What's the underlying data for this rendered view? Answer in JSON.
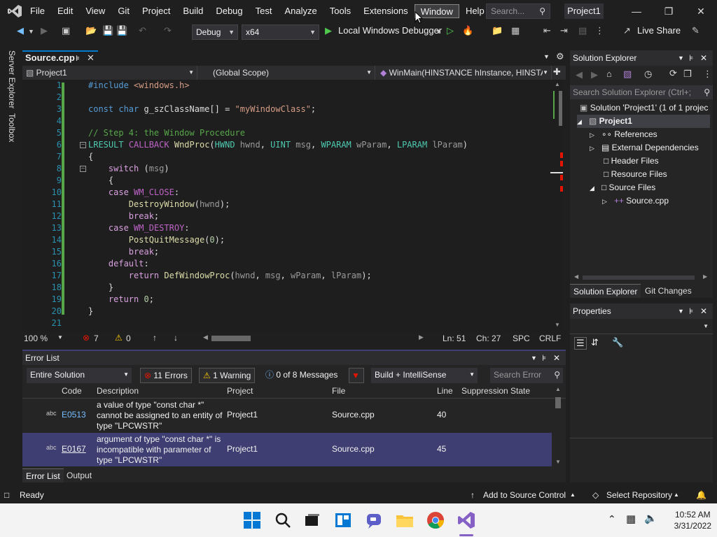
{
  "menubar": {
    "items": [
      "File",
      "Edit",
      "View",
      "Git",
      "Project",
      "Build",
      "Debug",
      "Test",
      "Analyze",
      "Tools",
      "Extensions",
      "Window",
      "Help"
    ],
    "search_placeholder": "Search...",
    "project_badge": "Project1"
  },
  "toolbar": {
    "config": "Debug",
    "platform": "x64",
    "debugger": "Local Windows Debugger",
    "live_share": "Live Share"
  },
  "left_sidebar": {
    "server_explorer": "Server Explorer",
    "toolbox": "Toolbox"
  },
  "editor": {
    "tab": "Source.cpp",
    "nav_project": "Project1",
    "nav_scope": "(Global Scope)",
    "nav_member": "WinMain(HINSTANCE hInstance, HINSTA",
    "lines": [
      {
        "n": "1",
        "t": "#include <windows.h>"
      },
      {
        "n": "2",
        "t": ""
      },
      {
        "n": "3",
        "t": "const char g_szClassName[] = \"myWindowClass\";"
      },
      {
        "n": "4",
        "t": ""
      },
      {
        "n": "5",
        "t": "// Step 4: the Window Procedure"
      },
      {
        "n": "6",
        "t": "LRESULT CALLBACK WndProc(HWND hwnd, UINT msg, WPARAM wParam, LPARAM lParam)"
      },
      {
        "n": "7",
        "t": "{"
      },
      {
        "n": "8",
        "t": "    switch (msg)"
      },
      {
        "n": "9",
        "t": "    {"
      },
      {
        "n": "10",
        "t": "    case WM_CLOSE:"
      },
      {
        "n": "11",
        "t": "        DestroyWindow(hwnd);"
      },
      {
        "n": "12",
        "t": "        break;"
      },
      {
        "n": "13",
        "t": "    case WM_DESTROY:"
      },
      {
        "n": "14",
        "t": "        PostQuitMessage(0);"
      },
      {
        "n": "15",
        "t": "        break;"
      },
      {
        "n": "16",
        "t": "    default:"
      },
      {
        "n": "17",
        "t": "        return DefWindowProc(hwnd, msg, wParam, lParam);"
      },
      {
        "n": "18",
        "t": "    }"
      },
      {
        "n": "19",
        "t": "    return 0;"
      },
      {
        "n": "20",
        "t": "}"
      },
      {
        "n": "21",
        "t": ""
      }
    ],
    "zoom": "100 %",
    "errors_count": "7",
    "warnings_count": "0",
    "line": "Ln: 51",
    "col": "Ch: 27",
    "spacing": "SPC",
    "eol": "CRLF"
  },
  "error_list": {
    "title": "Error List",
    "scope": "Entire Solution",
    "errors_btn": "11 Errors",
    "warnings_btn": "1 Warning",
    "messages_btn": "0 of 8 Messages",
    "build_filter": "Build + IntelliSense",
    "search_placeholder": "Search Error",
    "columns": {
      "code": "Code",
      "description": "Description",
      "project": "Project",
      "file": "File",
      "line": "Line",
      "suppression": "Suppression State"
    },
    "rows": [
      {
        "code": "E0513",
        "desc1": "a value of type \"const char *\"",
        "desc2": "cannot be assigned to an entity of",
        "desc3": "type \"LPCWSTR\"",
        "project": "Project1",
        "file": "Source.cpp",
        "line": "40"
      },
      {
        "code": "E0167",
        "desc1": "argument of type \"const char *\" is",
        "desc2": "incompatible with parameter of",
        "desc3": "type \"LPCWSTR\"",
        "project": "Project1",
        "file": "Source.cpp",
        "line": "45"
      }
    ],
    "tabs": [
      "Error List",
      "Output"
    ]
  },
  "solution_explorer": {
    "title": "Solution Explorer",
    "search_placeholder": "Search Solution Explorer (Ctrl+;",
    "nodes": {
      "solution": "Solution 'Project1' (1 of 1 projec",
      "project": "Project1",
      "references": "References",
      "external": "External Dependencies",
      "header": "Header Files",
      "resource": "Resource Files",
      "source": "Source Files",
      "source_cpp": "Source.cpp"
    },
    "tabs": [
      "Solution Explorer",
      "Git Changes"
    ]
  },
  "properties": {
    "title": "Properties"
  },
  "statusbar": {
    "ready": "Ready",
    "source_control": "Add to Source Control",
    "repository": "Select Repository"
  },
  "taskbar": {
    "time": "10:52 AM",
    "date": "3/31/2022"
  },
  "colors": {
    "accent": "#007acc",
    "selection": "#3e3e72",
    "vs_purple": "#68217a"
  }
}
